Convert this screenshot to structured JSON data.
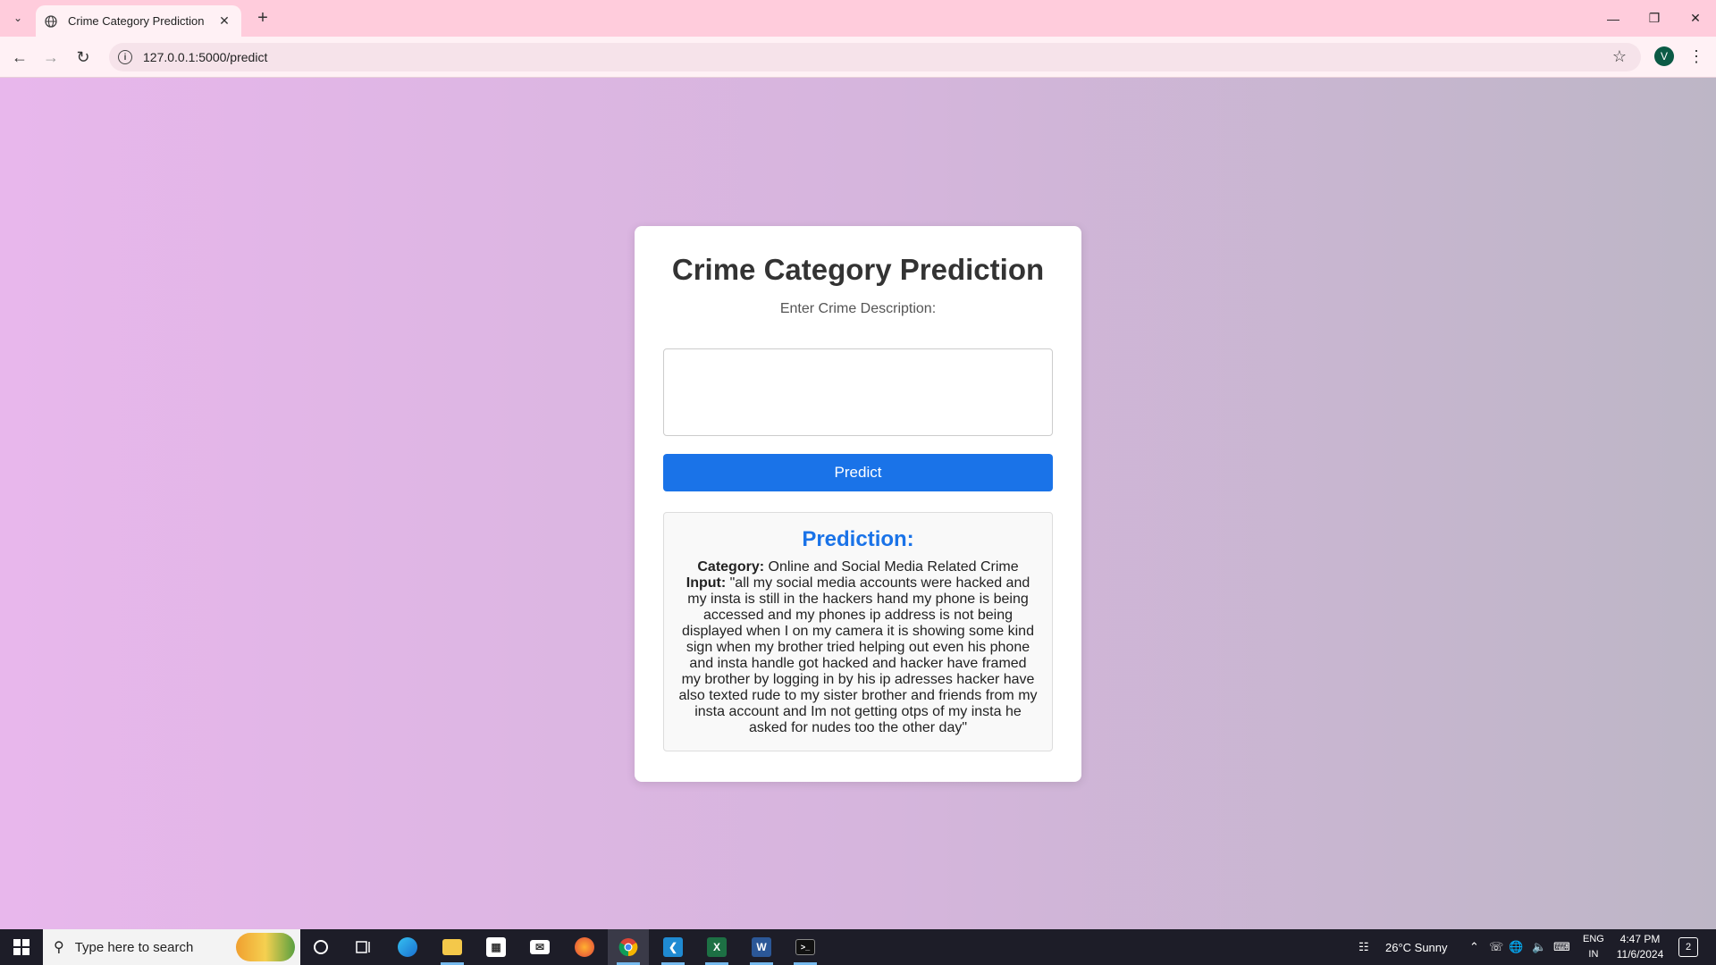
{
  "browser": {
    "tab_title": "Crime Category Prediction",
    "url": "127.0.0.1:5000/predict",
    "profile_initial": "V"
  },
  "page": {
    "title": "Crime Category Prediction",
    "input_label": "Enter Crime Description:",
    "textarea_value": "",
    "button_label": "Predict",
    "result": {
      "heading": "Prediction:",
      "category_label": "Category:",
      "category_value": "Online and Social Media Related Crime",
      "input_label": "Input:",
      "input_value": "\"all my social media accounts were hacked and my insta is still in the hackers hand my phone is being accessed and my phones ip address is not being displayed when I on my camera it is showing some kind sign when my brother tried helping out even his phone and insta handle got hacked and hacker have framed my brother by logging in by his ip adresses hacker have also texted rude to my sister brother and friends from my insta account and Im not getting otps of my insta he asked for nudes too the other day\""
    }
  },
  "taskbar": {
    "search_placeholder": "Type here to search",
    "weather": "26°C  Sunny",
    "lang_line1": "ENG",
    "lang_line2": "IN",
    "time": "4:47 PM",
    "date": "11/6/2024",
    "notification_count": "2"
  },
  "colors": {
    "accent": "#1a73e8",
    "tabbar": "#ffccdc"
  }
}
